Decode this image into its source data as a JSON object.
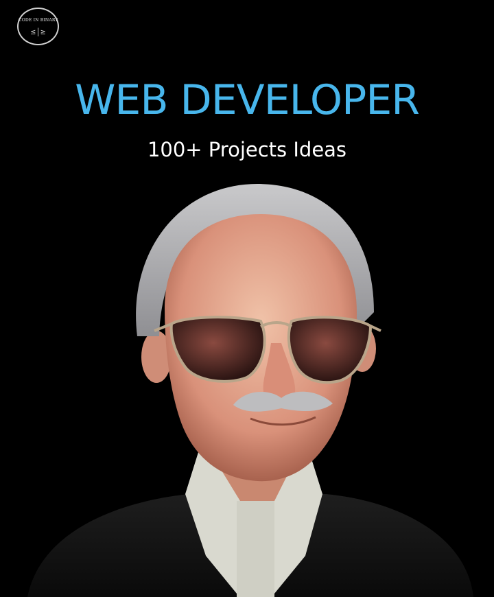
{
  "logo": {
    "text": "CODE IN BINARY",
    "glyph": "≤|≥"
  },
  "heading": {
    "title": "WEB DEVELOPER",
    "subtitle": "100+ Projects Ideas"
  },
  "illustration": {
    "icon": "elderly-man-sunglasses-portrait"
  },
  "colors": {
    "background": "#000000",
    "title": "#48b6ec",
    "subtitle": "#ffffff"
  }
}
